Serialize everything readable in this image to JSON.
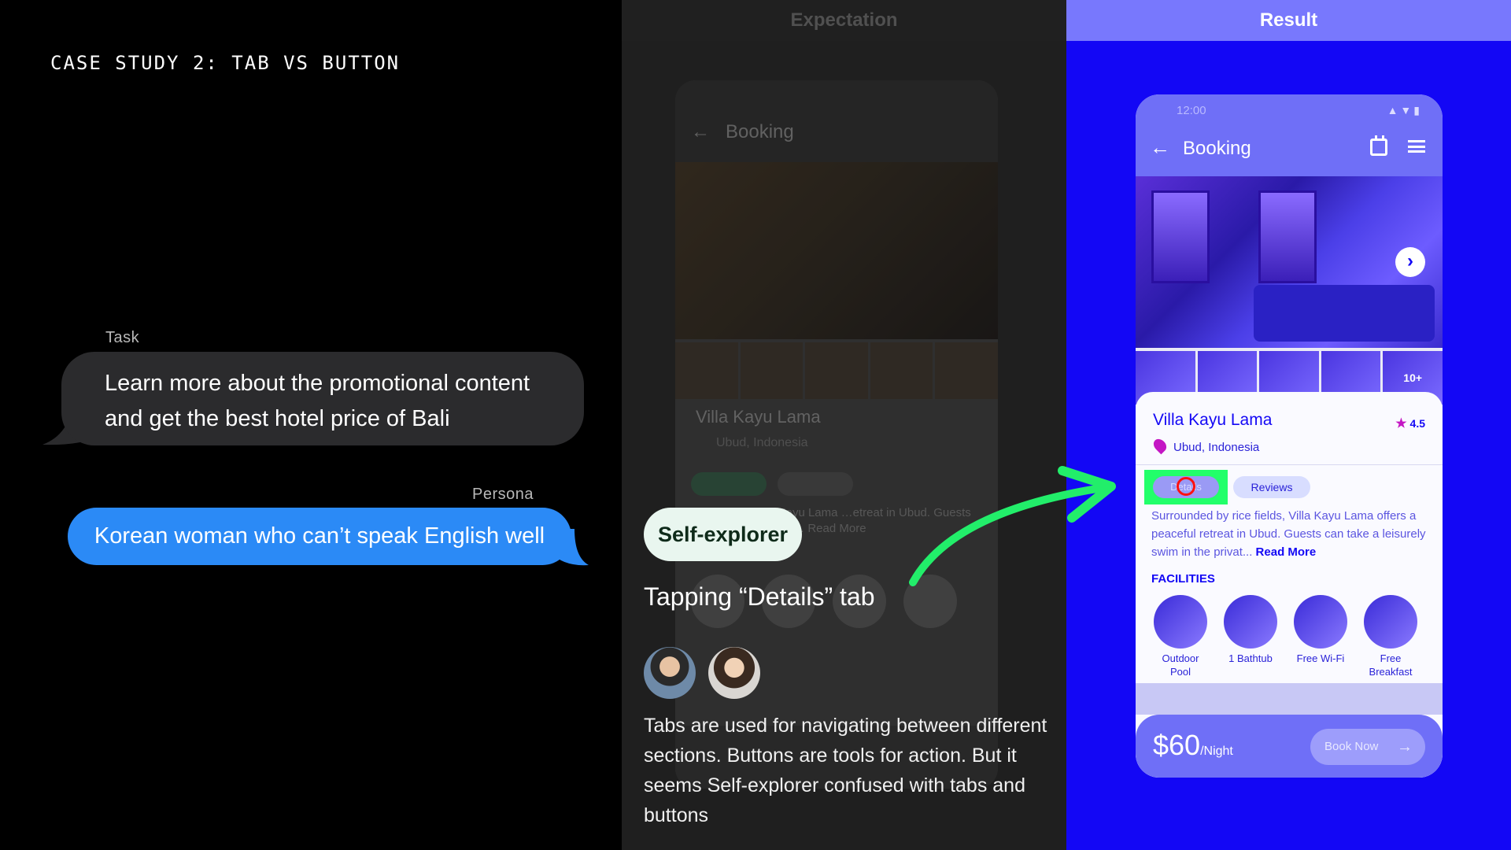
{
  "left": {
    "case_title": "CASE STUDY 2: TAB VS BUTTON",
    "task_label": "Task",
    "task_text": "Learn more about the promotional content and get the best hotel price of Bali",
    "persona_label": "Persona",
    "persona_text": "Korean woman who can’t speak English well"
  },
  "middle": {
    "header": "Expectation",
    "badge": "Self-explorer",
    "action_title": "Tapping “Details” tab",
    "description": "Tabs are used for navigating between different sections. Buttons are tools for action. But it seems Self-explorer confused with tabs and buttons",
    "ghost": {
      "title": "Booking",
      "hotel_name": "Villa Kayu Lama",
      "location": "Ubud, Indonesia",
      "desc": "…ce fields, Villa Kayu Lama …etreat in Ubud. Guests … swim in … privat… Read More"
    }
  },
  "right": {
    "header": "Result",
    "phone": {
      "time": "12:00",
      "title": "Booking",
      "more_photos": "10+",
      "hotel_name": "Villa Kayu Lama",
      "rating": "4.5",
      "location": "Ubud, Indonesia",
      "tab_details": "Details",
      "tab_reviews": "Reviews",
      "description": "Surrounded by rice fields, Villa Kayu Lama offers a peaceful retreat in Ubud. Guests can take a leisurely swim in the privat...",
      "read_more": "Read More",
      "facilities_label": "FACILITIES",
      "facilities": [
        "Outdoor Pool",
        "1 Bathtub",
        "Free Wi-Fi",
        "Free Breakfast"
      ],
      "price": "$60",
      "price_unit": "/Night",
      "book_button": "Book Now"
    }
  },
  "colors": {
    "result_bg": "#1307f5",
    "highlight": "#22ff6a",
    "tap_marker": "#ff1111",
    "bubble_blue": "#2b8af6"
  }
}
